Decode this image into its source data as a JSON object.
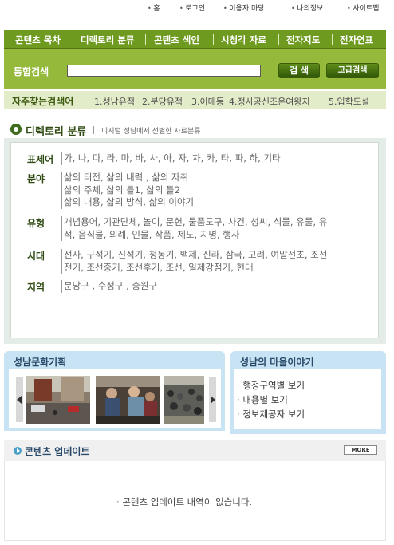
{
  "top_links": [
    "홈",
    "로그인",
    "이용자 마당",
    "나의정보",
    "사이트맵"
  ],
  "main_nav": [
    "콘텐츠 목차",
    "디렉토리 분류",
    "콘텐츠 색인",
    "시청각 자료",
    "전자지도",
    "전자연표"
  ],
  "search": {
    "label": "통합검색",
    "value": "",
    "search_button": "검 색",
    "advanced_button": "고급검색"
  },
  "popular": {
    "label": "자주찾는검색어",
    "keywords": [
      "1.성남유적",
      "2.분당유적",
      "3.이매동",
      "4.정사공신조온여왕지",
      "5.입학도설"
    ]
  },
  "directory": {
    "title": "디렉토리 분류",
    "subtitle": "디지털 성남에서 선별한 자료분류",
    "rows": [
      {
        "label": "표제어",
        "lines": [
          "가, 나, 다, 라, 마, 바, 사, 아, 자, 차, 카, 타, 파, 하, 기타"
        ]
      },
      {
        "label": "분야",
        "lines": [
          "삶의 터전, 삶의 내력 , 삶의 자취",
          "삶의 주체, 삶의 틀1, 삶의 틀2",
          "삶의 내용, 삶의 방식, 삶의 이야기"
        ]
      },
      {
        "label": "유형",
        "lines": [
          "개념용어, 기관단체, 놀이, 문헌, 물품도구, 사건, 성씨, 식물, 유물, 유",
          "적, 음식물, 의례, 인물, 작품, 제도, 지명, 행사"
        ]
      },
      {
        "label": "시대",
        "lines": [
          "선사, 구석기, 신석기, 청동기, 백제, 신라, 삼국, 고려, 여말선초, 조선",
          "전기, 조선중기, 조선후기, 조선, 일제강점기, 현대"
        ]
      },
      {
        "label": "지역",
        "lines": [
          "분당구 , 수정구 , 중원구"
        ]
      }
    ]
  },
  "culture": {
    "title": "성남문화기획"
  },
  "village": {
    "title": "성남의 마을이야기",
    "items": [
      "행정구역별 보기",
      "내용별 보기",
      "정보제공자 보기"
    ]
  },
  "updates": {
    "title": "콘텐츠 업데이트",
    "more_label": "MORE",
    "empty_message": "콘텐츠 업데이트 내역이 없습니다."
  },
  "colors": {
    "nav_green": "#6e9a1f",
    "search_green": "#95b93a",
    "keyword_bg": "#e3ecc9",
    "panel_blue": "#c8e3f3"
  }
}
